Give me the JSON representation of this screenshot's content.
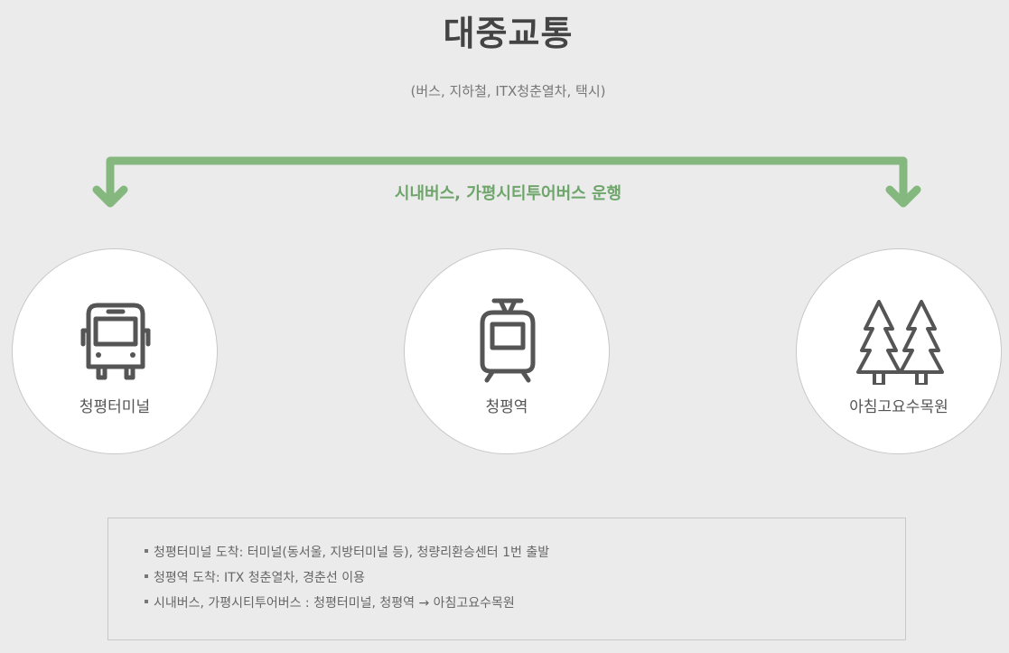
{
  "title": "대중교통",
  "subtitle": "(버스, 지하철, ITX청춘열차, 택시)",
  "route_label": "시내버스, 가평시티투어버스 운행",
  "colors": {
    "accent": "#85b87f",
    "accent_text": "#6ea56a",
    "icon": "#555555",
    "background": "#ebebeb"
  },
  "stops": [
    {
      "label": "청평터미널",
      "icon": "bus-icon"
    },
    {
      "label": "청평역",
      "icon": "tram-icon"
    },
    {
      "label": "아침고요수목원",
      "icon": "trees-icon"
    }
  ],
  "notes": [
    "청평터미널 도착: 터미널(동서울, 지방터미널 등), 청량리환승센터 1번 출발",
    "청평역 도착: ITX 청춘열차, 경춘선 이용",
    "시내버스, 가평시티투어버스 : 청평터미널, 청평역 → 아침고요수목원"
  ]
}
